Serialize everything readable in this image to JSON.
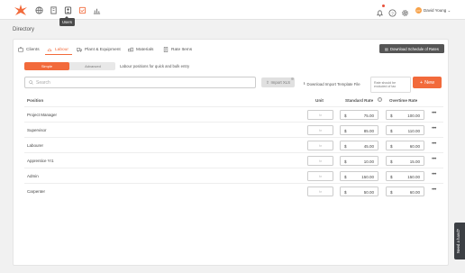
{
  "topbar": {
    "tooltip": "Users",
    "user_initials": "DY",
    "user_name": "David Young"
  },
  "page": {
    "title": "Directory",
    "download_label": "Download Schedule of Rates"
  },
  "tabs": [
    {
      "label": "Clients",
      "active": false
    },
    {
      "label": "Labour",
      "active": true
    },
    {
      "label": "Plant & Equipment",
      "active": false
    },
    {
      "label": "Materials",
      "active": false
    },
    {
      "label": "Rate Items",
      "active": false
    }
  ],
  "mode": {
    "simple": "Simple",
    "advanced": "Advanced",
    "description": "Labour positions for quick and bulk entry"
  },
  "toolbar": {
    "search_placeholder": "Search",
    "import_label": "Import XLS",
    "template_label": "Download Import Template File",
    "note": "Rate should be excluded of tax",
    "new_label": "New"
  },
  "table": {
    "headers": {
      "position": "Position",
      "unit": "Unit",
      "standard": "Standard Rate",
      "overtime": "Overtime Rate"
    },
    "unit_placeholder": "hr",
    "currency": "$",
    "rows": [
      {
        "position": "Project Manager",
        "standard": "75.00",
        "overtime": "100.00"
      },
      {
        "position": "Supervisor",
        "standard": "85.00",
        "overtime": "110.00"
      },
      {
        "position": "Labourer",
        "standard": "45.00",
        "overtime": "60.00"
      },
      {
        "position": "Apprentice Yr1",
        "standard": "10.00",
        "overtime": "15.00"
      },
      {
        "position": "Admin",
        "standard": "150.00",
        "overtime": "150.00"
      },
      {
        "position": "Carpenter",
        "standard": "50.00",
        "overtime": "60.00"
      }
    ]
  },
  "side_tab": {
    "label": "Need a hand?"
  },
  "colors": {
    "accent": "#f26a3b",
    "dark_button": "#555555"
  }
}
